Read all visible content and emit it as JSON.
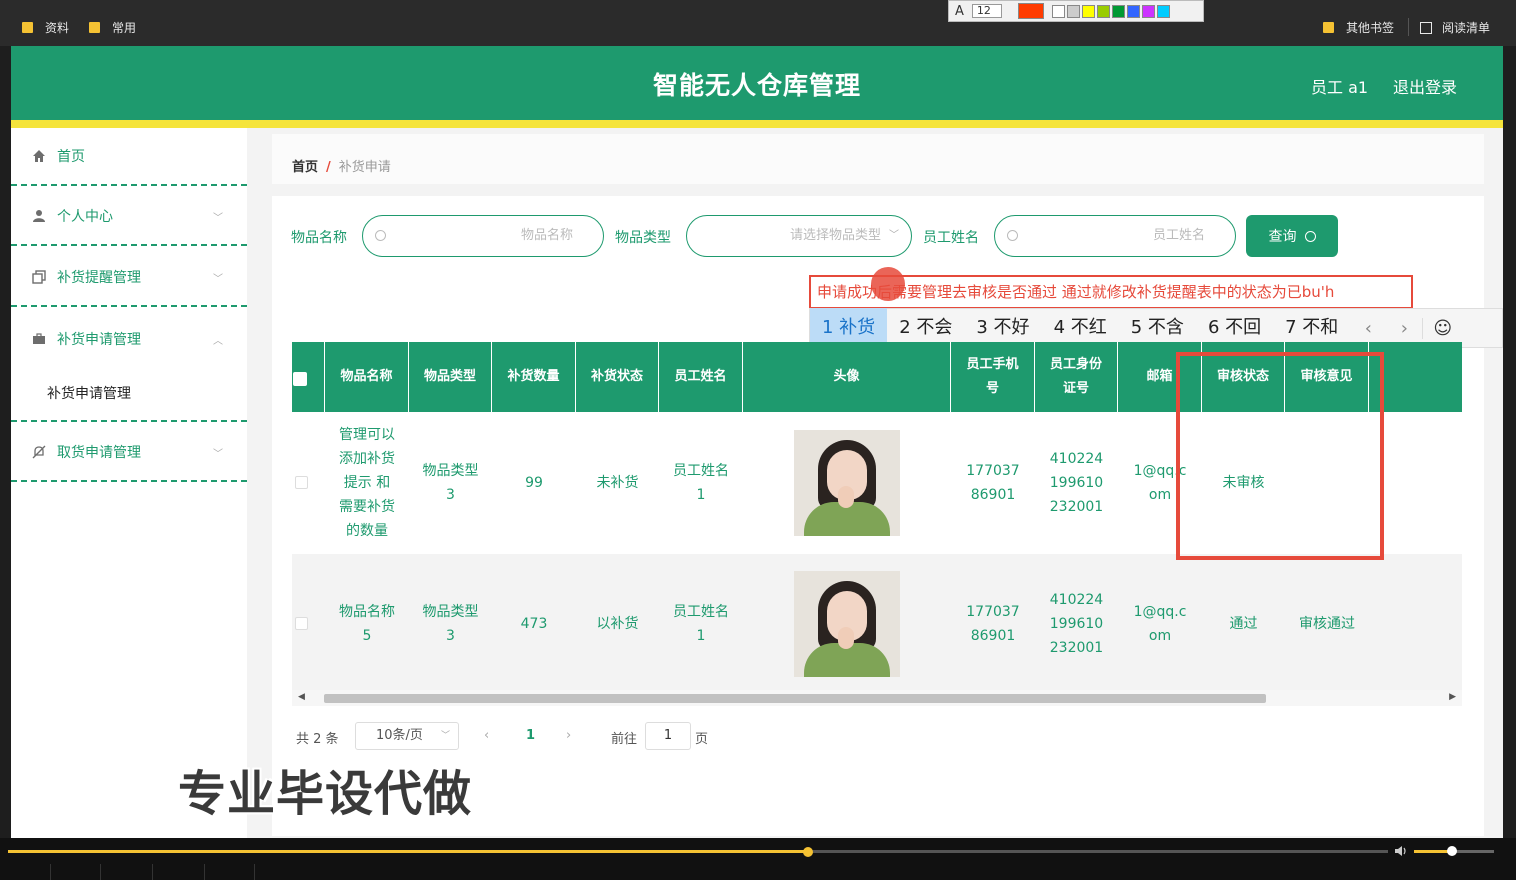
{
  "bookmarks": {
    "left": [
      {
        "label": "资料"
      },
      {
        "label": "常用"
      }
    ],
    "right": [
      {
        "label": "其他书签"
      },
      {
        "label": "阅读清单"
      }
    ]
  },
  "drawing_toolbar": {
    "font_icon": "A",
    "size": "12",
    "swatches": [
      "#ff3b00",
      "#ffffff",
      "#cccccc",
      "#ffff00",
      "#99cc00",
      "#009933",
      "#3366ff",
      "#cc33ff",
      "#00ccff"
    ]
  },
  "header": {
    "title": "智能无人仓库管理",
    "user": "员工 a1",
    "logout": "退出登录"
  },
  "sidebar": {
    "items": [
      {
        "label": "首页",
        "icon": "home-icon"
      },
      {
        "label": "个人中心",
        "icon": "user-icon"
      },
      {
        "label": "补货提醒管理",
        "icon": "copy-icon"
      },
      {
        "label": "补货申请管理",
        "icon": "briefcase-icon"
      },
      {
        "label": "取货申请管理",
        "icon": "bell-off-icon"
      }
    ],
    "sub_item": "补货申请管理"
  },
  "breadcrumb": {
    "home": "首页",
    "sep": "/",
    "current": "补货申请"
  },
  "filters": {
    "name_label": "物品名称",
    "name_placeholder": "物品名称",
    "type_label": "物品类型",
    "type_placeholder": "请选择物品类型",
    "staff_label": "员工姓名",
    "staff_placeholder": "员工姓名",
    "query_button": "查询"
  },
  "ime": {
    "text": "申请成功后需要管理去审核是否通过 通过就修改补货提醒表中的状态为已bu'h",
    "candidates": [
      "1 补货",
      "2 不会",
      "3 不好",
      "4 不红",
      "5 不含",
      "6 不回",
      "7 不和"
    ],
    "prev": "‹",
    "next": "›",
    "emoji": "☺"
  },
  "table": {
    "headers": [
      "物品名称",
      "物品类型",
      "补货数量",
      "补货状态",
      "员工姓名",
      "头像",
      "员工手机号",
      "员工身份证号",
      "邮箱",
      "审核状态",
      "审核意见"
    ],
    "rows": [
      [
        "管理可以添加补货提示 和需要补货的数量",
        "物品类型3",
        "99",
        "未补货",
        "员工姓名1",
        "",
        "17703786901",
        "410224199610232001",
        "1@qq.com",
        "未审核",
        ""
      ],
      [
        "物品名称5",
        "物品类型3",
        "473",
        "以补货",
        "员工姓名1",
        "",
        "17703786901",
        "410224199610232001",
        "1@qq.com",
        "通过",
        "审核通过"
      ]
    ]
  },
  "pagination": {
    "total": "共 2 条",
    "page_size": "10条/页",
    "prev": "‹",
    "current": "1",
    "next": "›",
    "goto_label": "前往",
    "goto_value": "1",
    "goto_unit": "页"
  },
  "watermark": "专业毕设代做",
  "video": {
    "progress": 0.58,
    "volume": 0.48
  }
}
